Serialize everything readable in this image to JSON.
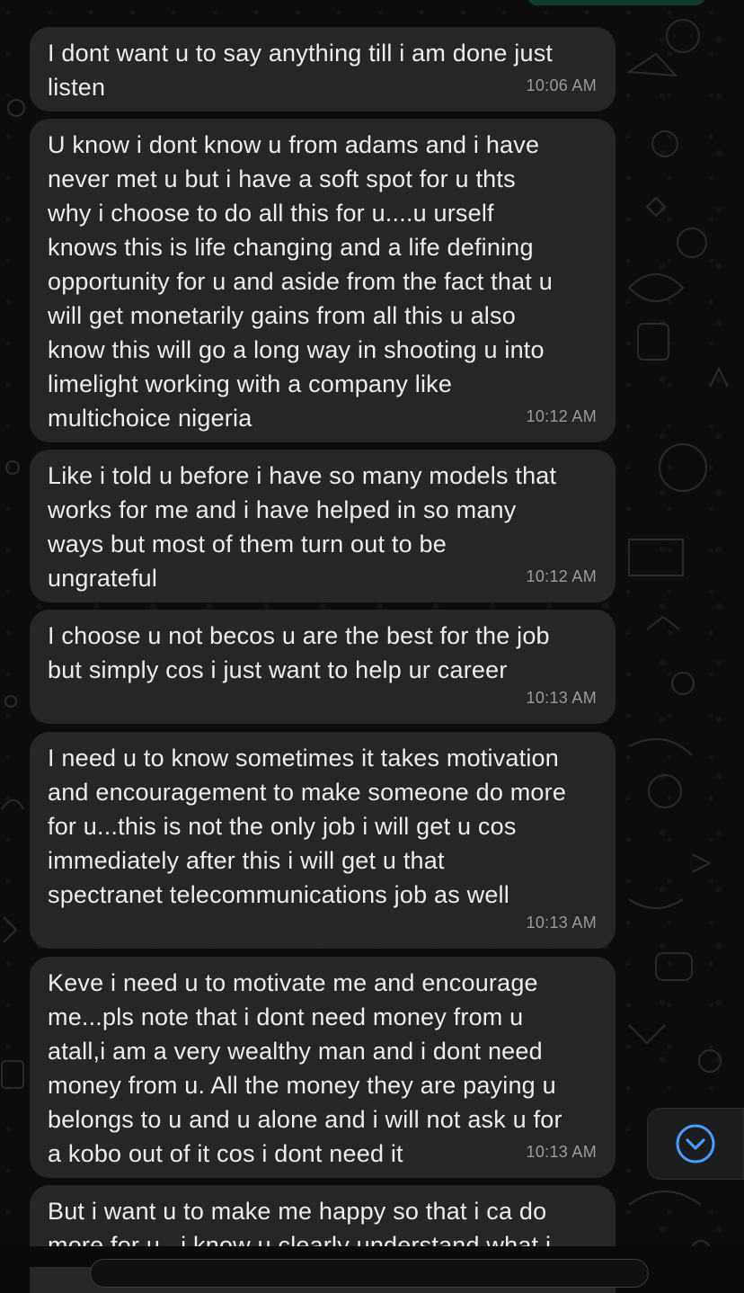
{
  "messages": [
    {
      "text": "I dont want u to say anything till i am done just\nlisten",
      "time": "10:06 AM"
    },
    {
      "text": "U know i dont know u from adams and i have\nnever met u but i have a soft spot for u thts\nwhy i choose to do all this for u....u urself\nknows this is life changing and a life defining\nopportunity for u and aside from the fact that u\nwill get monetarily gains from all this u also\nknow this will go a long way in shooting u into\nlimelight working with a company like\nmultichoice nigeria",
      "time": "10:12 AM"
    },
    {
      "text": "Like i told u before i have so many models that\nworks for me and i have helped in so many\nways but most of them turn out to be\nungrateful",
      "time": "10:12 AM"
    },
    {
      "text": "I choose u not becos u are the best for the job\nbut simply cos i just want to help ur career",
      "time": "10:13 AM"
    },
    {
      "text": "I need u to know sometimes it takes motivation\nand encouragement to make someone do more\nfor u...this is not the only job i will get u cos\nimmediately after this i will get u that\nspectranet telecommunications job as well",
      "time": "10:13 AM"
    },
    {
      "text": "Keve i need u to motivate me and encourage\nme...pls note that i dont need money from u\natall,i am a very wealthy man and i dont need\nmoney from u. All the money they are paying u\nbelongs to u and u alone and i will not ask u for\na kobo out of it cos i dont need it",
      "time": "10:13 AM"
    },
    {
      "text": "But i want u to make me happy so that i ca do\nmore for u...i know u clearly understand what i"
    }
  ],
  "icons": {
    "scroll_to_bottom": "chevron-down-circle-icon"
  },
  "colors": {
    "background": "#0b0b0b",
    "bubble": "#262626",
    "text": "#ececec",
    "timestamp": "#9a9a9a",
    "accent_blue": "#4a9eff"
  }
}
